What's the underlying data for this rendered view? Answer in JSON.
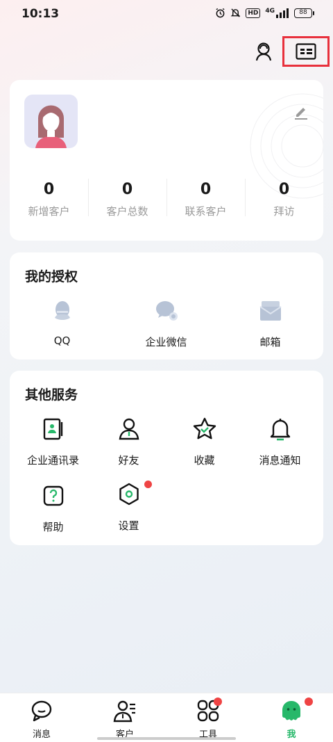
{
  "status_bar": {
    "time": "10:13",
    "network": "4G",
    "hd": "HD",
    "battery": "88"
  },
  "profile": {
    "stats": [
      {
        "value": "0",
        "label": "新增客户"
      },
      {
        "value": "0",
        "label": "客户总数"
      },
      {
        "value": "0",
        "label": "联系客户"
      },
      {
        "value": "0",
        "label": "拜访"
      }
    ]
  },
  "authorization": {
    "title": "我的授权",
    "items": [
      {
        "label": "QQ",
        "icon": "qq-icon"
      },
      {
        "label": "企业微信",
        "icon": "wecom-icon"
      },
      {
        "label": "邮箱",
        "icon": "mail-icon"
      }
    ]
  },
  "other_services": {
    "title": "其他服务",
    "items": [
      {
        "label": "企业通讯录",
        "icon": "contacts-book-icon"
      },
      {
        "label": "好友",
        "icon": "friend-icon"
      },
      {
        "label": "收藏",
        "icon": "star-icon"
      },
      {
        "label": "消息通知",
        "icon": "bell-icon"
      },
      {
        "label": "帮助",
        "icon": "help-icon"
      },
      {
        "label": "设置",
        "icon": "settings-icon"
      }
    ]
  },
  "tabbar": {
    "items": [
      {
        "label": "消息",
        "icon": "message-icon"
      },
      {
        "label": "客户",
        "icon": "customer-icon"
      },
      {
        "label": "工具",
        "icon": "tools-icon"
      },
      {
        "label": "我",
        "icon": "me-icon"
      }
    ],
    "active": "我"
  },
  "colors": {
    "accent": "#27b86a",
    "badge": "#ef4444",
    "highlight_border": "#e8303c"
  }
}
